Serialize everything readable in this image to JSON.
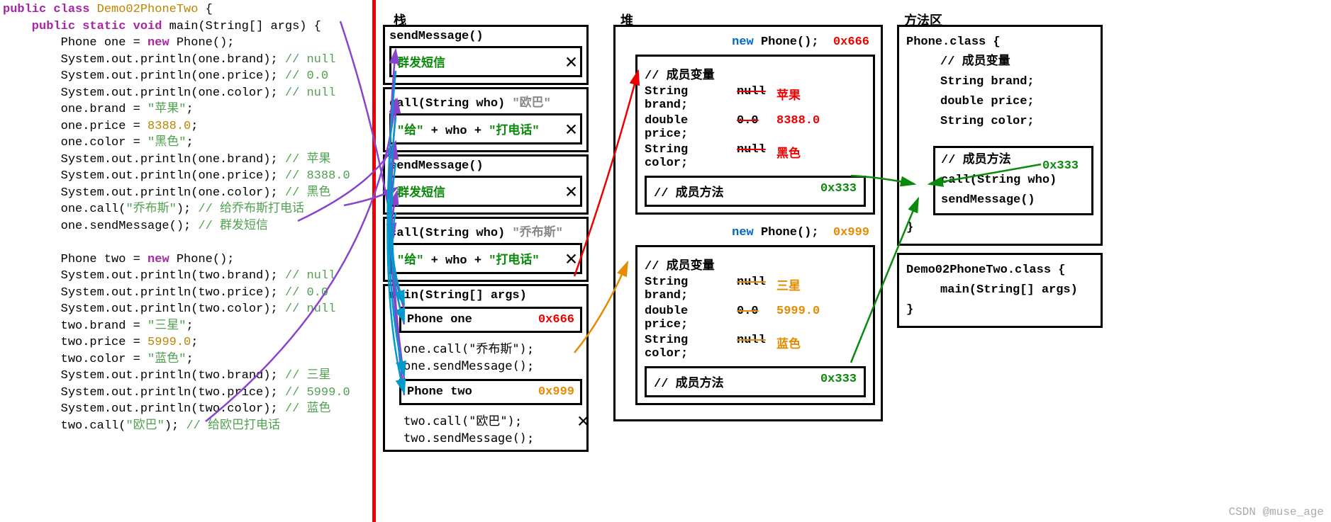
{
  "code": {
    "l1a": "public class ",
    "l1b": "Demo02PhoneTwo ",
    "l1c": "{",
    "l2a": "    public static void ",
    "l2b": "main",
    "l2c": "(String[] args) {",
    "l3a": "        Phone one = ",
    "l3b": "new ",
    "l3c": "Phone();",
    "l4a": "        System.out.println(one.brand); ",
    "l4b": "// null",
    "l5a": "        System.out.println(one.price); ",
    "l5b": "// 0.0",
    "l6a": "        System.out.println(one.color); ",
    "l6b": "// null",
    "l7a": "        one.brand = ",
    "l7b": "\"苹果\"",
    "l7c": ";",
    "l8a": "        one.price = ",
    "l8b": "8388.0",
    "l8c": ";",
    "l9a": "        one.color = ",
    "l9b": "\"黑色\"",
    "l9c": ";",
    "l10a": "        System.out.println(one.brand); ",
    "l10b": "// 苹果",
    "l11a": "        System.out.println(one.price); ",
    "l11b": "// 8388.0",
    "l12a": "        System.out.println(one.color); ",
    "l12b": "// 黑色",
    "l13a": "        one.call(",
    "l13b": "\"乔布斯\"",
    "l13c": "); ",
    "l13d": "// 给乔布斯打电话",
    "l14a": "        one.sendMessage(); ",
    "l14b": "// 群发短信",
    "l15": " ",
    "l16a": "        Phone two = ",
    "l16b": "new ",
    "l16c": "Phone();",
    "l17a": "        System.out.println(two.brand); ",
    "l17b": "// null",
    "l18a": "        System.out.println(two.price); ",
    "l18b": "// 0.0",
    "l19a": "        System.out.println(two.color); ",
    "l19b": "// null",
    "l20a": "        two.brand = ",
    "l20b": "\"三星\"",
    "l20c": ";",
    "l21a": "        two.price = ",
    "l21b": "5999.0",
    "l21c": ";",
    "l22a": "        two.color = ",
    "l22b": "\"蓝色\"",
    "l22c": ";",
    "l23a": "        System.out.println(two.brand); ",
    "l23b": "// 三星",
    "l24a": "        System.out.println(two.price); ",
    "l24b": "// 5999.0",
    "l25a": "        System.out.println(two.color); ",
    "l25b": "// 蓝色",
    "l26a": "        two.call(",
    "l26b": "\"欧巴\"",
    "l26c": "); ",
    "l26d": "// 给欧巴打电话"
  },
  "titles": {
    "stack": "栈",
    "heap": "堆",
    "methodArea": "方法区"
  },
  "stack": {
    "f1_title": "sendMessage()",
    "f1_body": "群发短信",
    "f2_title": "call(String who)",
    "f2_arg": "\"欧巴\"",
    "f2_a": "\"给\"",
    "f2_b": " + who + ",
    "f2_c": "\"打电话\"",
    "f3_title": "sendMessage()",
    "f3_body": "群发短信",
    "f4_title": "call(String who)",
    "f4_arg": "\"乔布斯\"",
    "f4_a": "\"给\"",
    "f4_b": " + who + ",
    "f4_c": "\"打电话\"",
    "main_title": "main(String[] args)",
    "main_one_lbl": "Phone one",
    "main_one_addr": "0x666",
    "main_line1": "one.call(\"乔布斯\");",
    "main_line2": "one.sendMessage();",
    "main_two_lbl": "Phone two",
    "main_two_addr": "0x999",
    "main_line3": "two.call(\"欧巴\");",
    "main_line4": "two.sendMessage();"
  },
  "heap": {
    "new_kw": "new ",
    "new_call": "Phone();",
    "addr1": "0x666",
    "addr2": "0x999",
    "vars_title": "// 成员变量",
    "brand_lbl": "String brand;",
    "brand_old": "null",
    "brand_new1": "苹果",
    "brand_new2": "三星",
    "price_lbl": "double price;",
    "price_old": "0.0",
    "price_new1": "8388.0",
    "price_new2": "5999.0",
    "color_lbl": "String color;",
    "color_old": "null",
    "color_new1": "黑色",
    "color_new2": "蓝色",
    "methods_title": "// 成员方法",
    "methods_addr": "0x333"
  },
  "ma": {
    "phone_class": "Phone.class {",
    "vars_comment": "// 成员变量",
    "brand": "String brand;",
    "price": "double price;",
    "color": "String color;",
    "methods_comment": "// 成员方法",
    "call": "call(String who)",
    "send": "sendMessage()",
    "close": "}",
    "addr": "0x333",
    "demo_class": "Demo02PhoneTwo.class {",
    "main": "main(String[] args)",
    "close2": "}"
  },
  "watermark": "CSDN @muse_age"
}
